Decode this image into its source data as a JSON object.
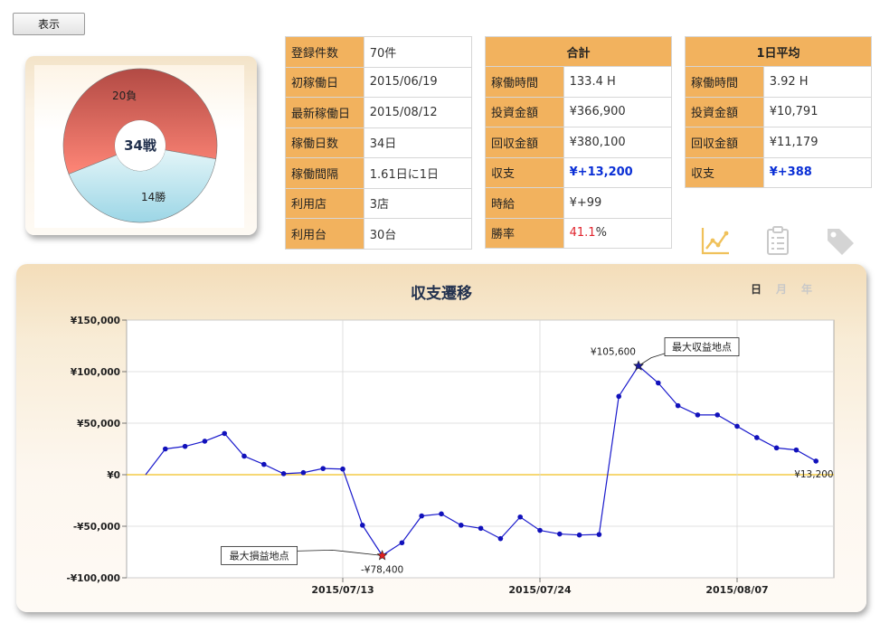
{
  "toolbar": {
    "show_label": "表示"
  },
  "summary_donut": {
    "center_label": "34戦",
    "lose_label": "20負",
    "win_label": "14勝",
    "wins": 14,
    "losses": 20,
    "colors": {
      "lose": "#f0766a",
      "win": "#bfe6ef"
    }
  },
  "registration_table": {
    "rows": [
      {
        "key": "登録件数",
        "value": "70件"
      },
      {
        "key": "初稼働日",
        "value": "2015/06/19"
      },
      {
        "key": "最新稼働日",
        "value": "2015/08/12"
      },
      {
        "key": "稼働日数",
        "value": "34日"
      },
      {
        "key": "稼働間隔",
        "value": "1.61日に1日"
      },
      {
        "key": "利用店",
        "value": "3店"
      },
      {
        "key": "利用台",
        "value": "30台"
      }
    ]
  },
  "total_table": {
    "header": "合計",
    "rows": [
      {
        "key": "稼働時間",
        "value": "133.4 H"
      },
      {
        "key": "投資金額",
        "value": "¥366,900"
      },
      {
        "key": "回収金額",
        "value": "¥380,100"
      },
      {
        "key": "収支",
        "value_prefix": "¥",
        "value": "+13,200"
      },
      {
        "key": "時給",
        "value": "¥+99"
      },
      {
        "key": "勝率",
        "value_red": "41.1",
        "value_suffix": "%"
      }
    ]
  },
  "daily_avg_table": {
    "header": "1日平均",
    "rows": [
      {
        "key": "稼働時間",
        "value": "3.92 H"
      },
      {
        "key": "投資金額",
        "value": "¥10,791"
      },
      {
        "key": "回収金額",
        "value": "¥11,179"
      },
      {
        "key": "収支",
        "value_prefix": "¥",
        "value": "+388"
      }
    ]
  },
  "view_icons": [
    "line-chart-icon",
    "clipboard-icon",
    "tag-icon"
  ],
  "colors": {
    "accent_orange": "#f2b25e",
    "line": "#1a1acc",
    "zero_line": "#f0c020",
    "profit_blue": "#0a2fd6",
    "rate_red": "#e0232d"
  },
  "chart_data": {
    "type": "line",
    "title": "収支遷移",
    "range_tabs": [
      {
        "label": "日",
        "active": true
      },
      {
        "label": "月",
        "active": false
      },
      {
        "label": "年",
        "active": false
      }
    ],
    "ylim": [
      -100000,
      150000
    ],
    "y_ticks": [
      {
        "value": 150000,
        "label": "¥150,000"
      },
      {
        "value": 100000,
        "label": "¥100,000"
      },
      {
        "value": 50000,
        "label": "¥50,000"
      },
      {
        "value": 0,
        "label": "¥0"
      },
      {
        "value": -50000,
        "label": "-¥50,000"
      },
      {
        "value": -100000,
        "label": "-¥100,000"
      }
    ],
    "x_ticks": [
      "2015/07/13",
      "2015/07/24",
      "2015/08/07"
    ],
    "x_tick_positions": [
      10,
      20,
      30
    ],
    "grid": true,
    "series": [
      {
        "values": [
          0,
          25000,
          27500,
          32500,
          40000,
          18000,
          10000,
          1000,
          2000,
          6000,
          5500,
          -49000,
          -78400,
          -66000,
          -40000,
          -38000,
          -49000,
          -52000,
          -62000,
          -41000,
          -54000,
          -57500,
          -58500,
          -58000,
          76000,
          105600,
          89000,
          67000,
          58000,
          58000,
          47000,
          36000,
          26000,
          24000,
          13200
        ]
      }
    ],
    "annotations": [
      {
        "label": "最大収益地点",
        "value_label": "¥105,600",
        "index": 25
      },
      {
        "label": "最大損益地点",
        "value_label": "-¥78,400",
        "index": 12
      },
      {
        "label": "",
        "value_label": "¥13,200",
        "index": 34
      }
    ]
  }
}
